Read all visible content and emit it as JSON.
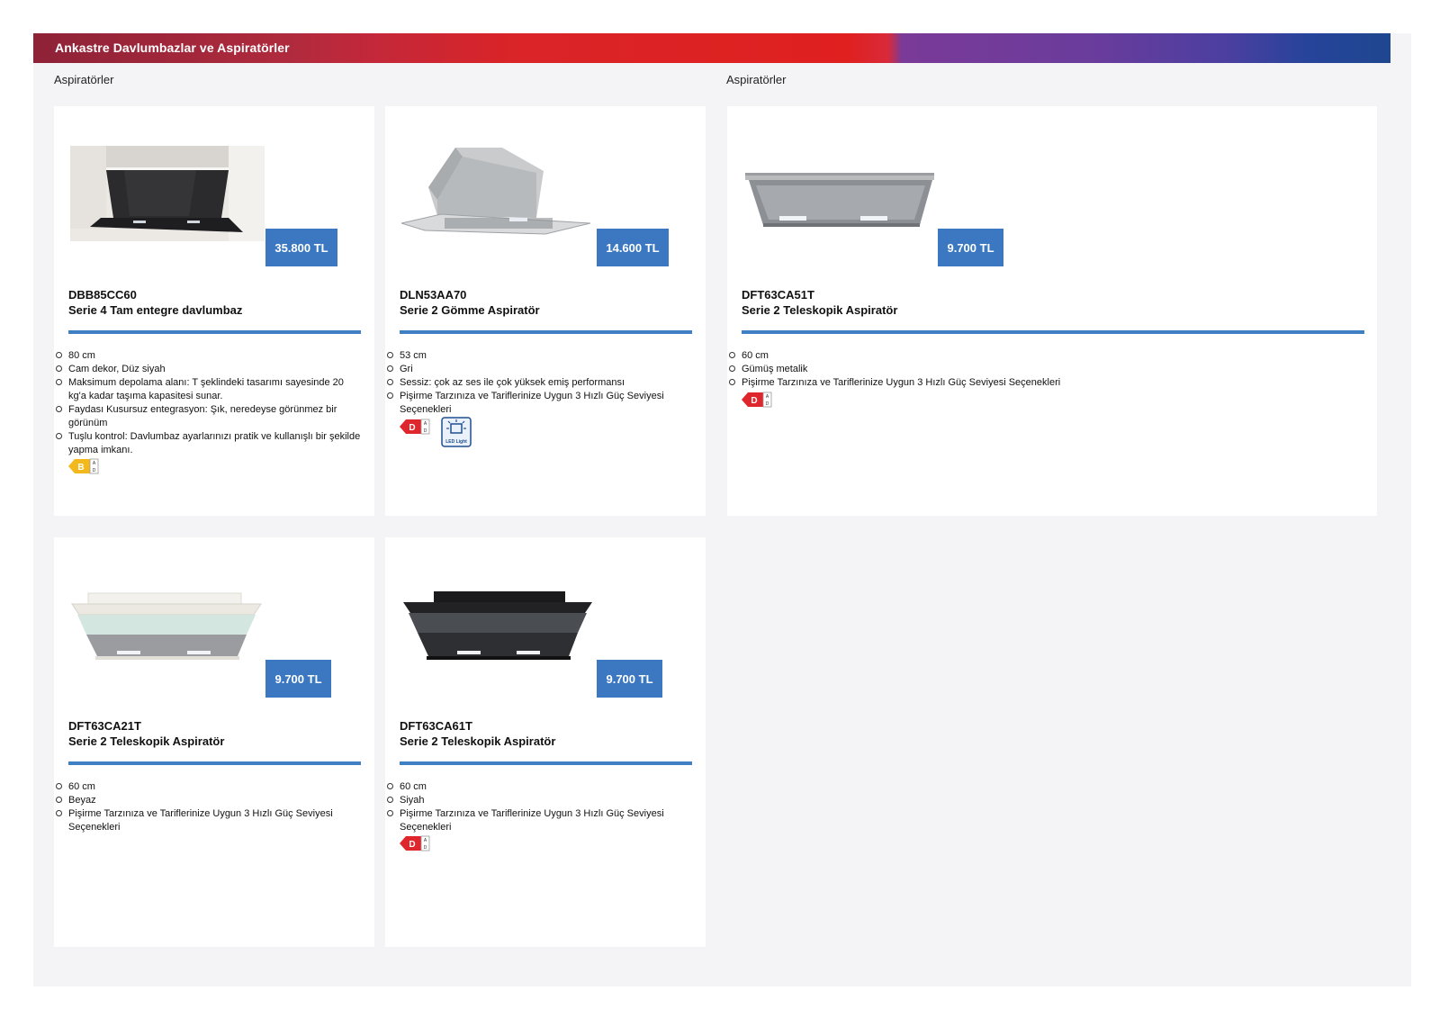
{
  "banner": {
    "title": "Ankastre Davlumbazlar ve Aspiratörler"
  },
  "sections": {
    "left_label": "Aspiratörler",
    "right_label": "Aspiratörler"
  },
  "products": [
    {
      "model": "DBB85CC60",
      "name": "Serie 4 Tam entegre davlumbaz",
      "price": "35.800 TL",
      "features": [
        "80 cm",
        "Cam dekor, Düz siyah",
        "Maksimum depolama alanı: T şeklindeki tasarımı sayesinde 20 kg'a kadar taşıma kapasitesi sunar.",
        "Faydası Kusursuz entegrasyon: Şık, neredeyse görünmez bir görünüm",
        "Tuşlu kontrol: Davlumbaz ayarlarınızı pratik ve kullanışlı bir şekilde yapma imkanı."
      ],
      "energy_class": "B",
      "energy_color": "#f2b81c",
      "image_icon": "integrated-hood-image"
    },
    {
      "model": "DLN53AA70",
      "name": "Serie 2 Gömme Aspiratör",
      "price": "14.600 TL",
      "features": [
        "53 cm",
        "Gri",
        "Sessiz: çok az ses ile çok yüksek emiş performansı",
        "Pişirme Tarzınıza ve Tariflerinize Uygun 3 Hızlı Güç Seviyesi Seçenekleri"
      ],
      "energy_class": "D",
      "energy_color": "#e0262d",
      "led_label": "LED Light",
      "image_icon": "built-in-hood-image"
    },
    {
      "model": "DFT63CA51T",
      "name": "Serie 2 Teleskopik Aspiratör",
      "price": "9.700 TL",
      "features": [
        "60 cm",
        "Gümüş metalik",
        "Pişirme Tarzınıza ve Tariflerinize Uygun 3 Hızlı Güç Seviyesi Seçenekleri"
      ],
      "energy_class": "D",
      "energy_color": "#e0262d",
      "image_icon": "telescopic-hood-silver-image"
    },
    {
      "model": "DFT63CA21T",
      "name": "Serie 2 Teleskopik Aspiratör",
      "price": "9.700 TL",
      "features": [
        "60 cm",
        "Beyaz",
        "Pişirme Tarzınıza ve Tariflerinize Uygun 3 Hızlı Güç Seviyesi Seçenekleri"
      ],
      "image_icon": "telescopic-hood-white-image"
    },
    {
      "model": "DFT63CA61T",
      "name": "Serie 2 Teleskopik Aspiratör",
      "price": "9.700 TL",
      "features": [
        "60 cm",
        "Siyah",
        "Pişirme Tarzınıza ve Tariflerinize Uygun 3 Hızlı Güç Seviyesi Seçenekleri"
      ],
      "energy_class": "D",
      "energy_color": "#e0262d",
      "image_icon": "telescopic-hood-black-image"
    }
  ],
  "colors": {
    "price_bg": "#3b78c1",
    "rule": "#3f7fc3",
    "page_bg": "#f4f4f6"
  }
}
